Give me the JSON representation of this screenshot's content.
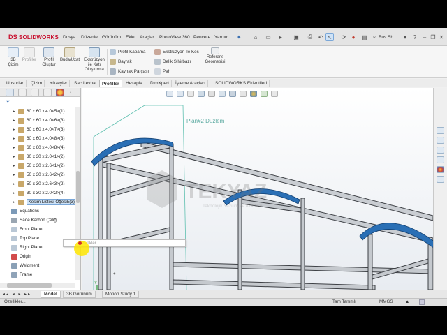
{
  "app": {
    "brand": "SOLIDWORKS",
    "brand_mark": "DS",
    "menu": [
      "Dosya",
      "Düzenle",
      "Görünüm",
      "Ekle",
      "Araçlar",
      "PhotoView 360",
      "Pencere",
      "Yardım"
    ],
    "search_label": "Bus Sh..."
  },
  "ribbon": {
    "big_buttons": [
      {
        "label": "3B\nÇizim",
        "icon": "3d-sketch-icon"
      },
      {
        "label": "Profiller",
        "icon": "profiles-icon"
      },
      {
        "label": "Profil\nOluştur",
        "icon": "structure-member-icon"
      },
      {
        "label": "Buda/Uzat",
        "icon": "trim-extend-icon"
      },
      {
        "label": "Ekstrüzyon\nile Katı\nOluşturma",
        "icon": "extruded-boss-icon"
      }
    ],
    "small_col1": [
      "Profil Kapama",
      "Bayrak",
      "Kaynak Parçası"
    ],
    "small_col2": [
      "Ekstrüzyon ile Kes",
      "Delik Sihirbazı",
      "Pah"
    ],
    "ref_geometry": "Referans\nGeometrisi"
  },
  "tabs": [
    "Unsurlar",
    "Çizim",
    "Yüzeyler",
    "Sac Levha",
    "Profiller",
    "Hesapla",
    "DimXpert",
    "İşleme Araçları",
    "SOLIDWORKS Eklentileri"
  ],
  "active_tab": "Profiller",
  "tree": {
    "items": [
      {
        "label": "60 x 60 x 4.0<5>(1)",
        "icon": "cut-list-folder-icon",
        "arrow": true
      },
      {
        "label": "60 x 60 x 4.0<6>(3)",
        "icon": "cut-list-folder-icon",
        "arrow": true
      },
      {
        "label": "60 x 60 x 4.0<7>(3)",
        "icon": "cut-list-folder-icon",
        "arrow": true
      },
      {
        "label": "60 x 60 x 4.0<8>(3)",
        "icon": "cut-list-folder-icon",
        "arrow": true
      },
      {
        "label": "60 x 60 x 4.0<8>(4)",
        "icon": "cut-list-folder-icon",
        "arrow": true
      },
      {
        "label": "30 x 30 x 2.0<1>(2)",
        "icon": "cut-list-folder-icon",
        "arrow": true
      },
      {
        "label": "50 x 30 x 2.6<1>(2)",
        "icon": "cut-list-folder-icon",
        "arrow": true
      },
      {
        "label": "50 x 30 x 2.6<2>(2)",
        "icon": "cut-list-folder-icon",
        "arrow": true
      },
      {
        "label": "50 x 30 x 2.6<3>(2)",
        "icon": "cut-list-folder-icon",
        "arrow": true
      },
      {
        "label": "30 x 30 x 2.0<2>(4)",
        "icon": "cut-list-folder-icon",
        "arrow": true
      },
      {
        "label": "Kesim Listesi Öğesi5(3)",
        "icon": "cut-list-item-icon",
        "arrow": true,
        "selected": true
      },
      {
        "label": "Equations",
        "icon": "equations-icon",
        "arrow": false
      },
      {
        "label": "Sade Karbon Çeliği",
        "icon": "material-icon",
        "arrow": false
      },
      {
        "label": "Front Plane",
        "icon": "plane-icon",
        "arrow": false
      },
      {
        "label": "Top Plane",
        "icon": "plane-icon",
        "arrow": false
      },
      {
        "label": "Right Plane",
        "icon": "plane-icon",
        "arrow": false
      },
      {
        "label": "Origin",
        "icon": "origin-icon",
        "arrow": false
      },
      {
        "label": "Weldment",
        "icon": "weldment-icon",
        "arrow": false
      },
      {
        "label": "Frame",
        "icon": "sketch-icon",
        "arrow": false
      }
    ]
  },
  "popup": {
    "text": "Özellikler..."
  },
  "viewport": {
    "plane_label": "Plan#2 Düzlem",
    "watermark_title": "TEKYAZ",
    "watermark_sub": "Teknolojik Yazılım ve Akademi",
    "triad": {
      "x": "X",
      "y": "Y"
    }
  },
  "bottom_tabs": [
    "Model",
    "3B Görünüm",
    "Motion Study 1"
  ],
  "active_bottom_tab": "Model",
  "status": {
    "left": "Özellikler...",
    "mid": "Tam Tanımlı",
    "units": "MMGS",
    "arrow": "▲"
  },
  "colors": {
    "accent": "#c8102e",
    "arc": "#2a6fb5",
    "selection": "#cde2f7"
  }
}
